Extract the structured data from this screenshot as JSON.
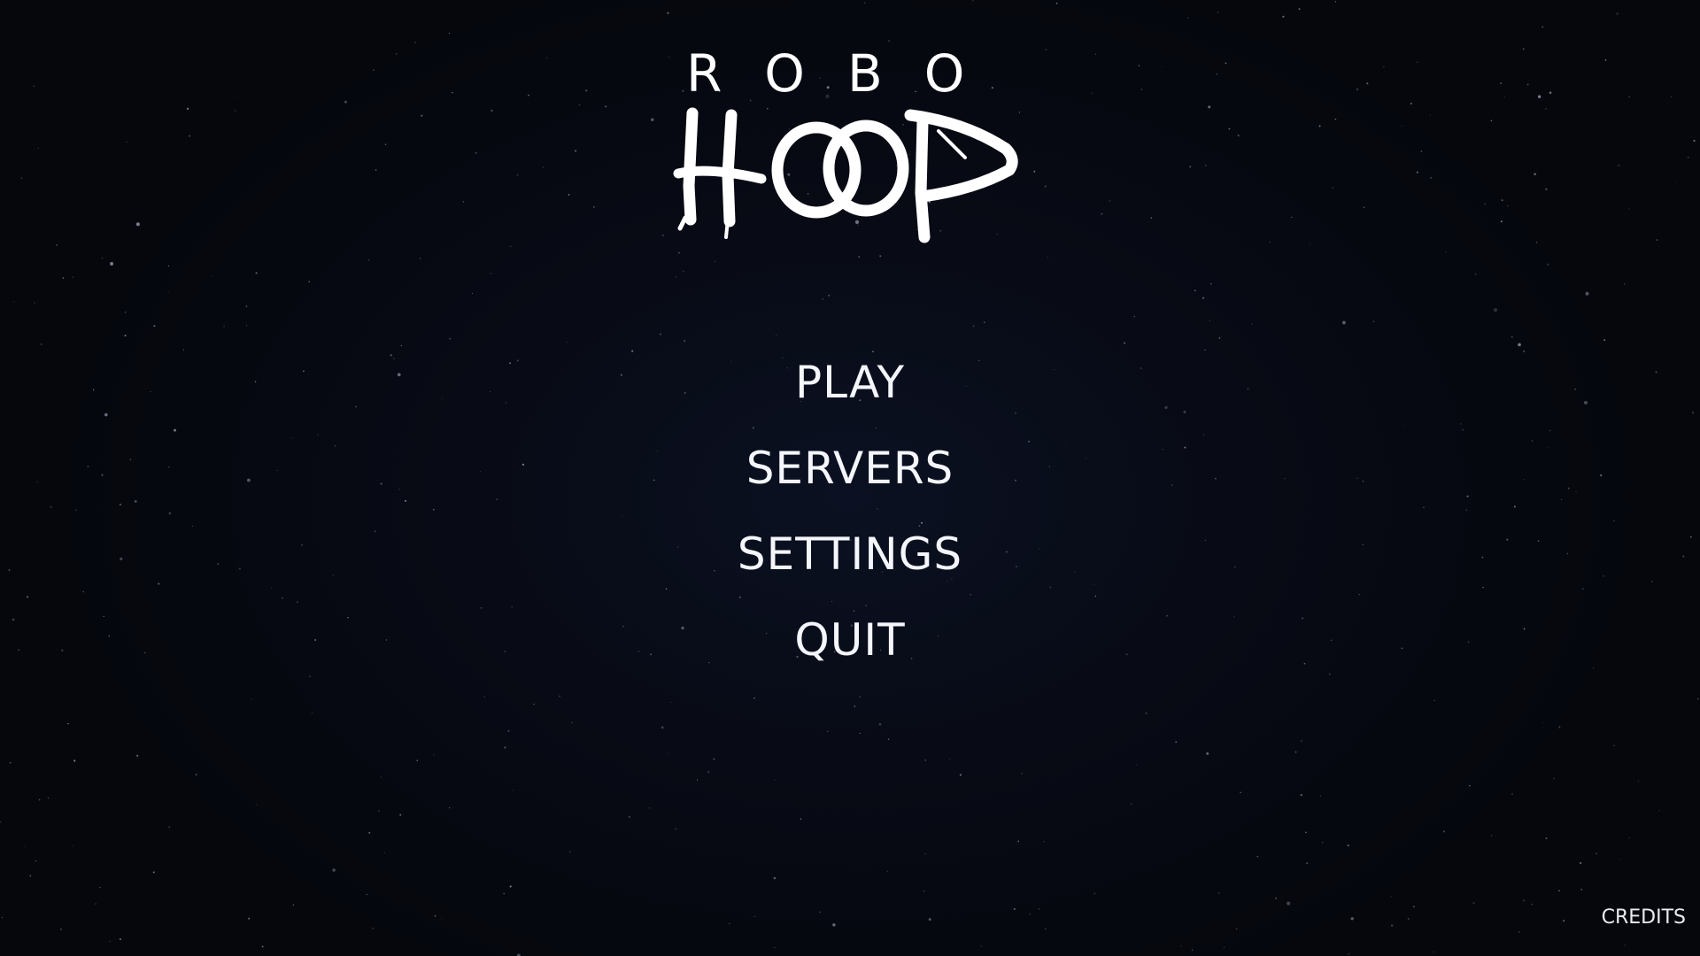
{
  "logo": {
    "top_word": "ROBO",
    "bottom_word": "HOOP"
  },
  "menu": {
    "items": [
      {
        "label": "PLAY"
      },
      {
        "label": "SERVERS"
      },
      {
        "label": "SETTINGS"
      },
      {
        "label": "QUIT"
      }
    ]
  },
  "footer": {
    "credits_label": "CREDITS"
  },
  "colors": {
    "background": "#06080f",
    "text": "#ffffff"
  }
}
